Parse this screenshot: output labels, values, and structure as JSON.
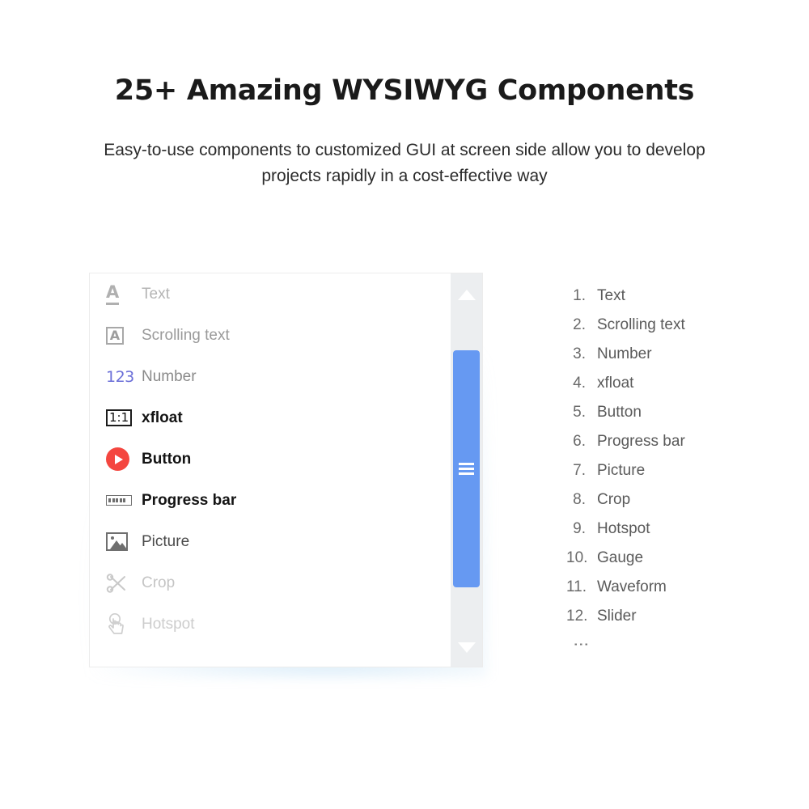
{
  "header": {
    "title": "25+ Amazing WYSIWYG Components",
    "subtitle": "Easy-to-use components to customized GUI at screen side allow you to develop projects rapidly in a cost-effective way"
  },
  "panel": {
    "components": [
      {
        "label": "Text",
        "icon": "text-underline-a-icon",
        "emphasis": "dim"
      },
      {
        "label": "Scrolling text",
        "icon": "boxed-a-icon",
        "emphasis": "mid"
      },
      {
        "label": "Number",
        "icon": "123-number-icon",
        "emphasis": "semi"
      },
      {
        "label": "xfloat",
        "icon": "one-to-one-ratio-icon",
        "emphasis": "strong"
      },
      {
        "label": "Button",
        "icon": "play-circle-icon",
        "emphasis": "strong"
      },
      {
        "label": "Progress bar",
        "icon": "progress-bar-icon",
        "emphasis": "strong"
      },
      {
        "label": "Picture",
        "icon": "picture-icon",
        "emphasis": "normal"
      },
      {
        "label": "Crop",
        "icon": "scissors-icon",
        "emphasis": "faint"
      },
      {
        "label": "Hotspot",
        "icon": "tap-hand-icon",
        "emphasis": "faintest"
      }
    ],
    "scrollbar": {
      "up_arrow": "scroll-up-arrow-icon",
      "down_arrow": "scroll-down-arrow-icon",
      "thumb": "scroll-thumb-grip"
    }
  },
  "list": {
    "items": [
      {
        "index": "1.",
        "label": "Text"
      },
      {
        "index": "2.",
        "label": "Scrolling text"
      },
      {
        "index": "3.",
        "label": "Number"
      },
      {
        "index": "4.",
        "label": "xfloat"
      },
      {
        "index": "5.",
        "label": "Button"
      },
      {
        "index": "6.",
        "label": "Progress bar"
      },
      {
        "index": "7.",
        "label": "Picture"
      },
      {
        "index": "8.",
        "label": "Crop"
      },
      {
        "index": "9.",
        "label": "Hotspot"
      },
      {
        "index": "10.",
        "label": "Gauge"
      },
      {
        "index": "11.",
        "label": "Waveform"
      },
      {
        "index": "12.",
        "label": "Slider"
      }
    ],
    "continuation": "⋮"
  },
  "colors": {
    "number_icon": "#6b6fd8",
    "button_icon": "#f4463f",
    "scroll_thumb": "#6699f2",
    "scroll_track": "#eceef0",
    "panel_border": "#ececec",
    "glow": "#8bc5eb"
  }
}
